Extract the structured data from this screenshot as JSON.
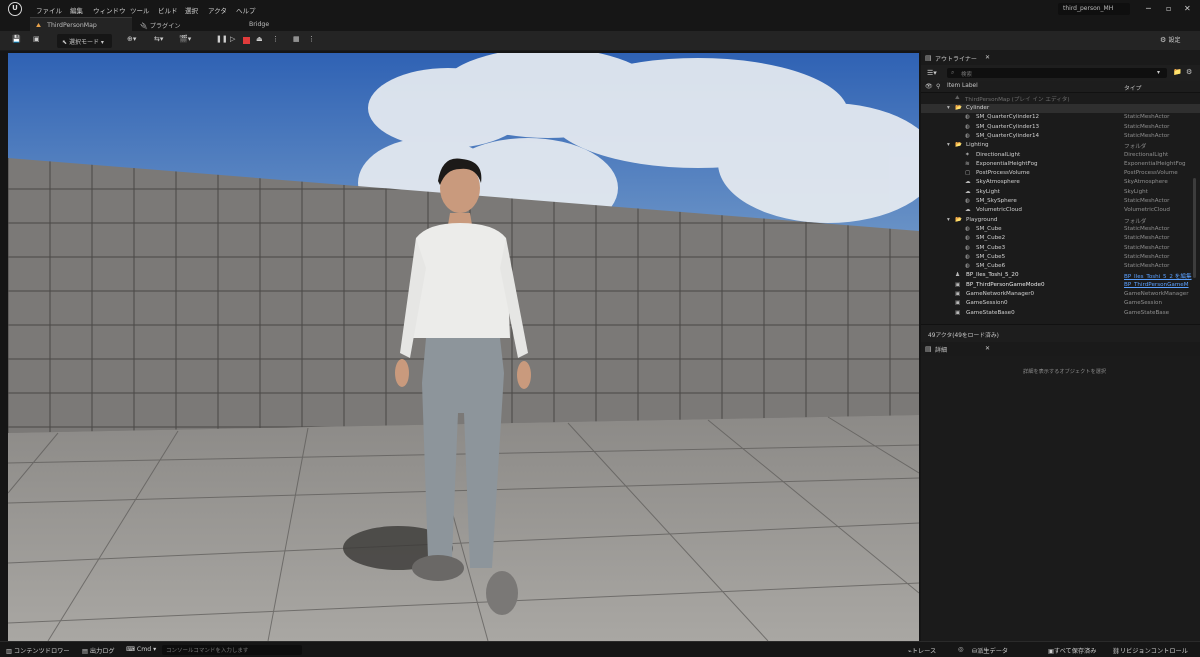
{
  "menu": {
    "logo": "U",
    "items": [
      "ファイル",
      "編集",
      "ウィンドウ",
      "ツール",
      "ビルド",
      "選択",
      "アクタ",
      "ヘルプ"
    ],
    "project": "third_person_MH",
    "controls": [
      "─",
      "▫",
      "✕"
    ]
  },
  "tabs": {
    "map": "ThirdPersonMap",
    "plugin": "プラグイン",
    "bridge": "Bridge"
  },
  "toolbar": {
    "mode": "選択モード",
    "settings": "設定"
  },
  "outliner": {
    "tab_title": "アウトライナー",
    "search_placeholder": "検索",
    "col_label": "Item Label",
    "col_type": "タイプ",
    "root": "ThirdPersonMap (プレイ イン エディタ)",
    "rows": [
      {
        "label": "Cylinder",
        "type": "",
        "kind": "folder",
        "indent": 1,
        "selected": true
      },
      {
        "label": "SM_QuarterCylinder12",
        "type": "StaticMeshActor",
        "kind": "mesh",
        "indent": 2
      },
      {
        "label": "SM_QuarterCylinder13",
        "type": "StaticMeshActor",
        "kind": "mesh",
        "indent": 2
      },
      {
        "label": "SM_QuarterCylinder14",
        "type": "StaticMeshActor",
        "kind": "mesh",
        "indent": 2
      },
      {
        "label": "Lighting",
        "type": "フォルダ",
        "kind": "folder",
        "indent": 1
      },
      {
        "label": "DirectionalLight",
        "type": "DirectionalLight",
        "kind": "light",
        "indent": 2
      },
      {
        "label": "ExponentialHeightFog",
        "type": "ExponentialHeightFog",
        "kind": "fog",
        "indent": 2
      },
      {
        "label": "PostProcessVolume",
        "type": "PostProcessVolume",
        "kind": "volume",
        "indent": 2
      },
      {
        "label": "SkyAtmosphere",
        "type": "SkyAtmosphere",
        "kind": "sky",
        "indent": 2
      },
      {
        "label": "SkyLight",
        "type": "SkyLight",
        "kind": "sky",
        "indent": 2
      },
      {
        "label": "SM_SkySphere",
        "type": "StaticMeshActor",
        "kind": "mesh",
        "indent": 2
      },
      {
        "label": "VolumetricCloud",
        "type": "VolumetricCloud",
        "kind": "cloud",
        "indent": 2
      },
      {
        "label": "Playground",
        "type": "フォルダ",
        "kind": "folder",
        "indent": 1
      },
      {
        "label": "SM_Cube",
        "type": "StaticMeshActor",
        "kind": "mesh",
        "indent": 2
      },
      {
        "label": "SM_Cube2",
        "type": "StaticMeshActor",
        "kind": "mesh",
        "indent": 2
      },
      {
        "label": "SM_Cube3",
        "type": "StaticMeshActor",
        "kind": "mesh",
        "indent": 2
      },
      {
        "label": "SM_Cube5",
        "type": "StaticMeshActor",
        "kind": "mesh",
        "indent": 2
      },
      {
        "label": "SM_Cube6",
        "type": "StaticMeshActor",
        "kind": "mesh",
        "indent": 2
      },
      {
        "label": "BP_Iles_Toshi_5_20",
        "type": "BP_Iles_Toshi_5_2 を編集",
        "kind": "pawn",
        "indent": 1,
        "link": true
      },
      {
        "label": "BP_ThirdPersonGameMode0",
        "type": "BP_ThirdPersonGameM",
        "kind": "actor",
        "indent": 1,
        "link": true
      },
      {
        "label": "GameNetworkManager0",
        "type": "GameNetworkManager",
        "kind": "actor",
        "indent": 1
      },
      {
        "label": "GameSession0",
        "type": "GameSession",
        "kind": "actor",
        "indent": 1
      },
      {
        "label": "GameStateBase0",
        "type": "GameStateBase",
        "kind": "actor",
        "indent": 1
      }
    ],
    "footer": "49アクタ(49をロード済み)"
  },
  "details": {
    "tab_title": "詳細",
    "empty_message": "詳細を表示するオブジェクトを選択"
  },
  "bottom": {
    "content_drawer": "コンテンツドロワー",
    "output_log": "出力ログ",
    "cmd": "Cmd",
    "console_placeholder": "コンソールコマンドを入力します",
    "trace": "トレース",
    "derived_data": "派生データ",
    "save_all": "すべて保存済み",
    "revision_control": "リビジョンコントロール"
  },
  "colors": {
    "accent": "#e8a24a",
    "stop": "#e03b3b",
    "link": "#5aa0ff",
    "folder": "#d9b45a"
  }
}
